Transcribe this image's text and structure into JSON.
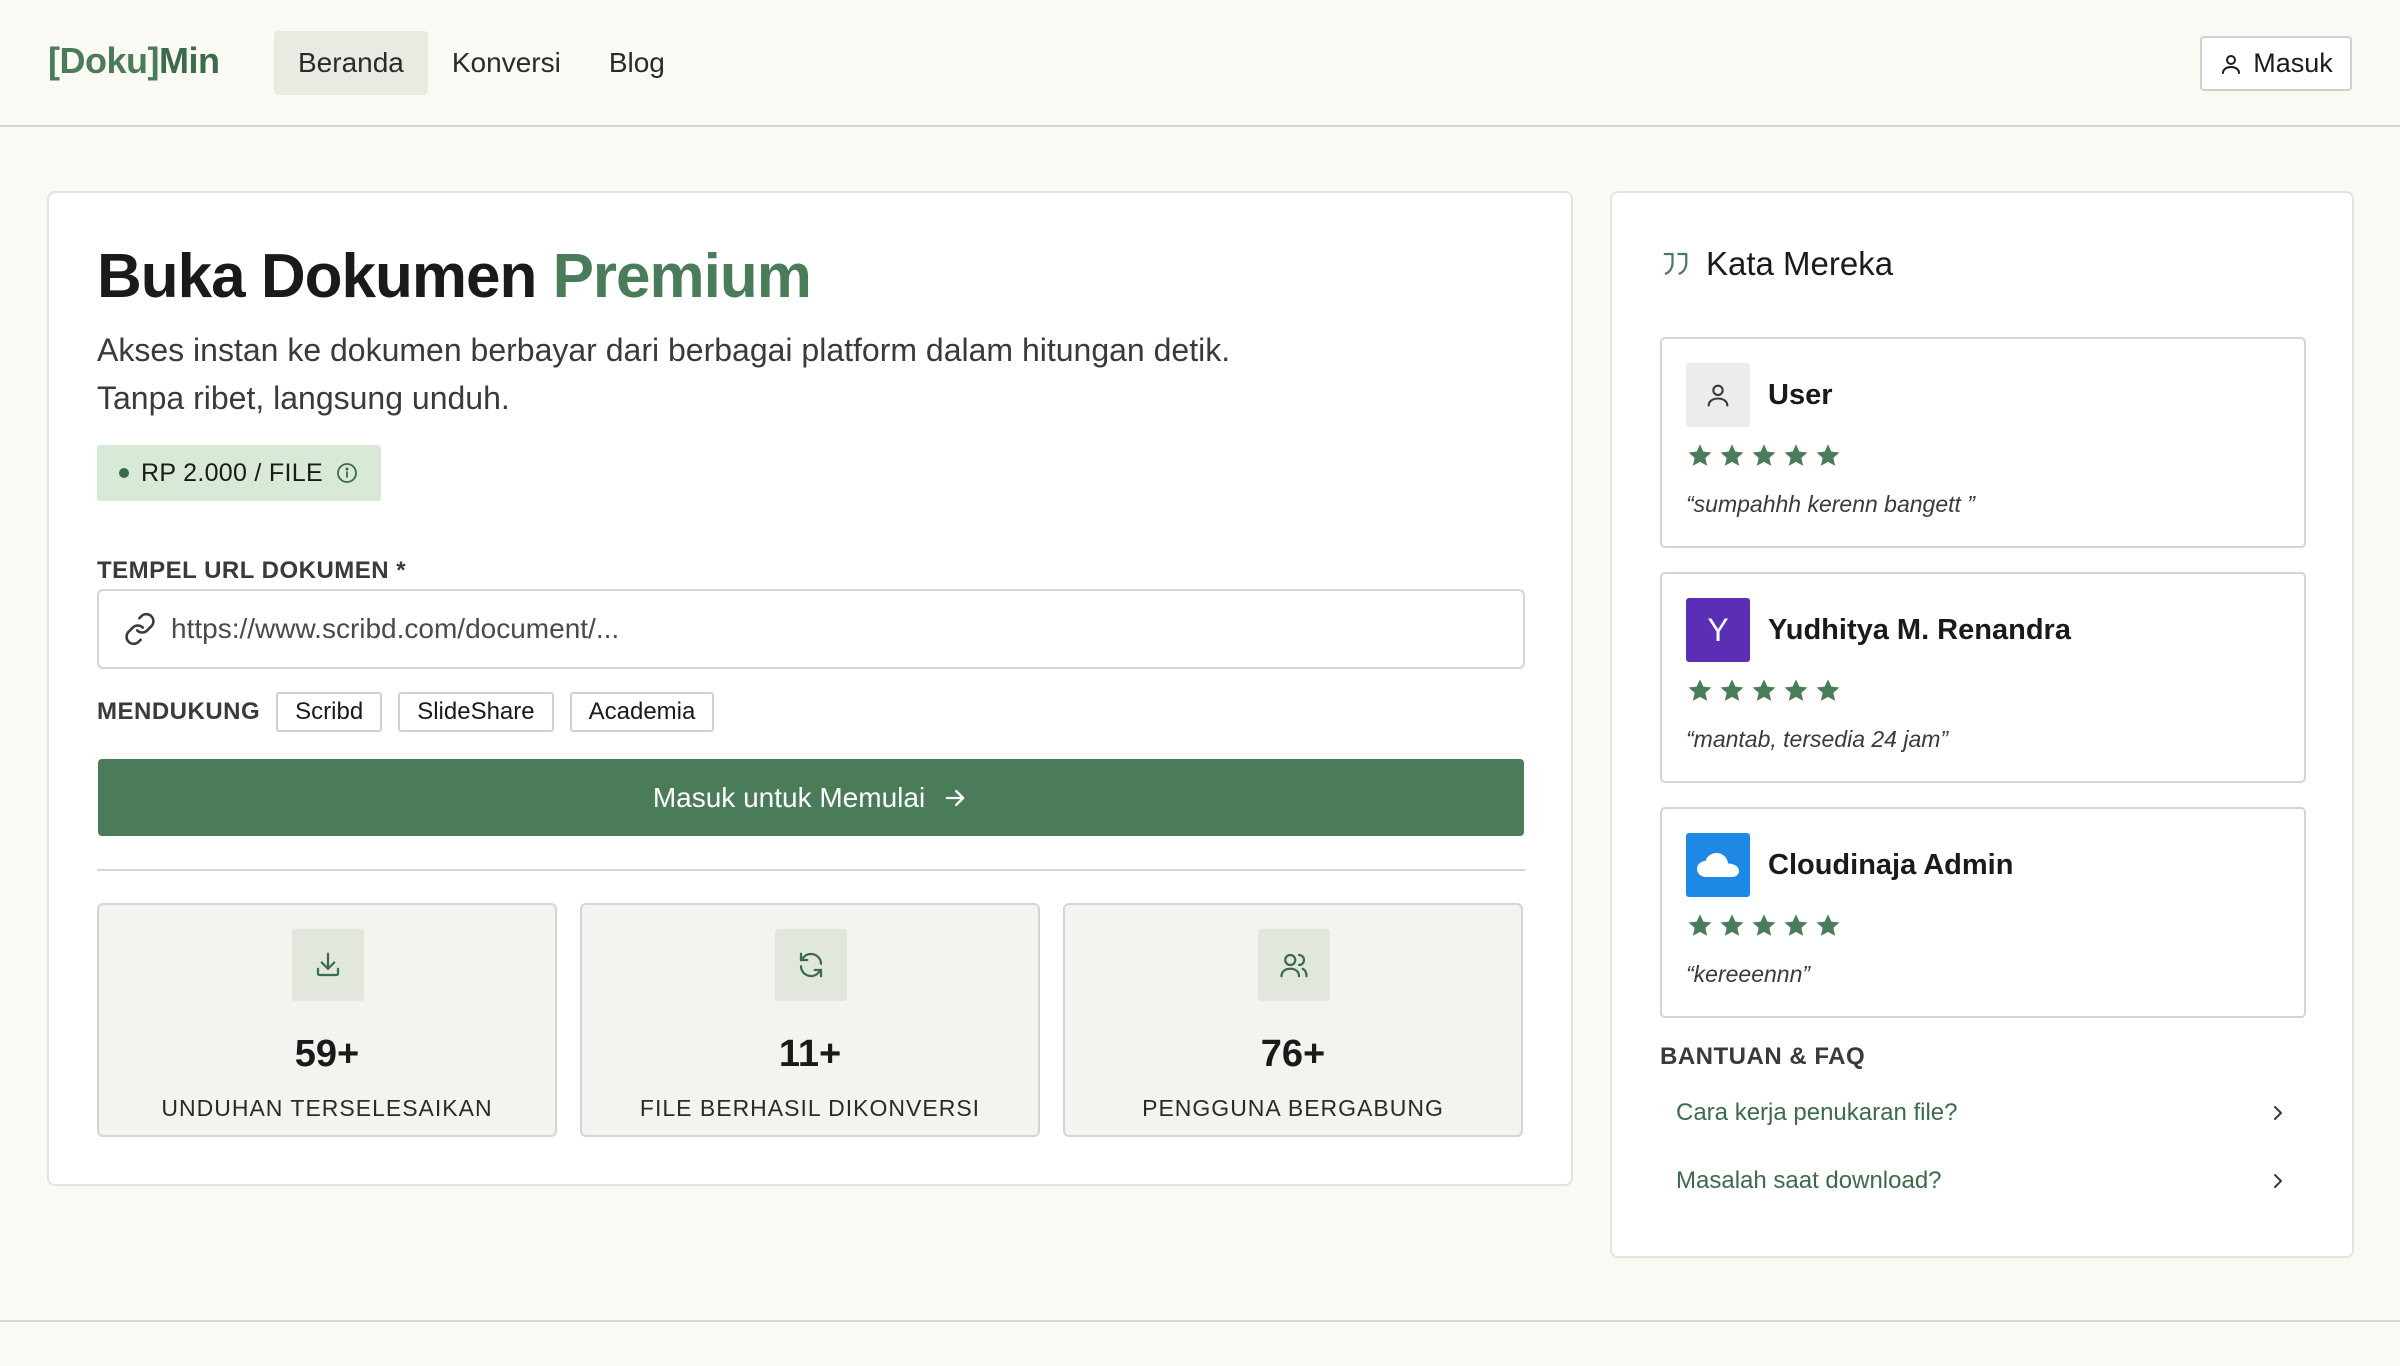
{
  "header": {
    "logo_bracket": "[Doku]",
    "logo_suffix": "Min",
    "nav": [
      {
        "label": "Beranda",
        "active": true
      },
      {
        "label": "Konversi",
        "active": false
      },
      {
        "label": "Blog",
        "active": false
      }
    ],
    "login_label": "Masuk"
  },
  "hero": {
    "title_main": "Buka Dokumen",
    "title_accent": "Premium",
    "subtitle": "Akses instan ke dokumen berbayar dari berbagai platform dalam hitungan detik. Tanpa ribet, langsung unduh.",
    "price_badge": "RP 2.000 / FILE"
  },
  "form": {
    "url_label": "TEMPEL URL DOKUMEN *",
    "url_placeholder": "https://www.scribd.com/document/...",
    "supports_label": "MENDUKUNG",
    "platforms": [
      "Scribd",
      "SlideShare",
      "Academia"
    ],
    "cta_label": "Masuk untuk Memulai"
  },
  "stats": [
    {
      "icon": "download-icon",
      "value": "59+",
      "label": "UNDUHAN TERSELESAIKAN"
    },
    {
      "icon": "refresh-icon",
      "value": "11+",
      "label": "FILE BERHASIL DIKONVERSI"
    },
    {
      "icon": "users-icon",
      "value": "76+",
      "label": "PENGGUNA BERGABUNG"
    }
  ],
  "testimonials": {
    "title": "Kata Mereka",
    "items": [
      {
        "name": "User",
        "avatar": "user-icon",
        "rating": 5,
        "quote": "“sumpahhh kerenn bangett ”"
      },
      {
        "name": "Yudhitya M. Renandra",
        "avatar_letter": "Y",
        "rating": 5,
        "quote": "“mantab, tersedia 24 jam”"
      },
      {
        "name": "Cloudinaja Admin",
        "avatar": "cloud-logo",
        "rating": 5,
        "quote": "“kereeennn”"
      }
    ]
  },
  "faq": {
    "title": "BANTUAN & FAQ",
    "items": [
      "Cara kerja penukaran file?",
      "Masalah saat download?"
    ]
  },
  "colors": {
    "accent": "#4a7c59",
    "background": "#fbf9f4",
    "badge_bg": "#d9e9d8",
    "star": "#4a7c59",
    "avatar_purple": "#5b2fb5",
    "avatar_blue": "#1e88e5"
  }
}
